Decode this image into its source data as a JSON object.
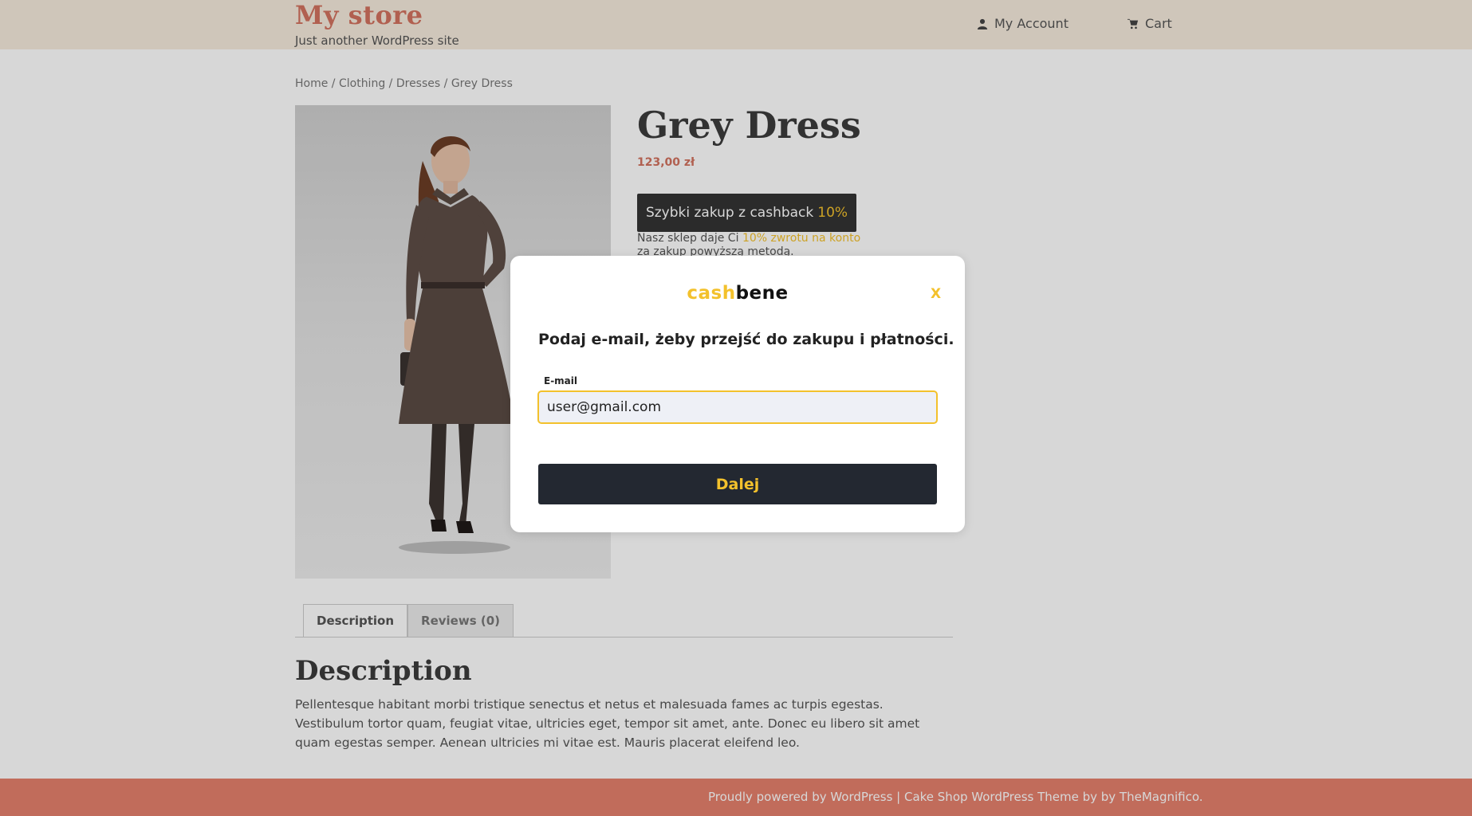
{
  "header": {
    "site_title": "My store",
    "site_description": "Just another WordPress site",
    "nav": {
      "account_label": "My Account",
      "cart_label": "Cart"
    }
  },
  "breadcrumb": {
    "items": [
      "Home",
      "Clothing",
      "Dresses",
      "Grey Dress"
    ],
    "separator": " / "
  },
  "product": {
    "title": "Grey Dress",
    "price": "123,00 zł",
    "cashback_button": {
      "label": "Szybki zakup z cashback",
      "percent": "10%"
    },
    "cashback_note": {
      "prefix": "Nasz sklep daje Ci",
      "highlight": "10% zwrotu na konto",
      "suffix": "za zakup powyższą metodą."
    }
  },
  "tabs": [
    {
      "label": "Description",
      "active": true
    },
    {
      "label": "Reviews (0)",
      "active": false
    }
  ],
  "description": {
    "title": "Description",
    "text": "Pellentesque habitant morbi tristique senectus et netus et malesuada fames ac turpis egestas. Vestibulum tortor quam, feugiat vitae, ultricies eget, tempor sit amet, ante. Donec eu libero sit amet quam egestas semper. Aenean ultricies mi vitae est. Mauris placerat eleifend leo."
  },
  "footer": {
    "text": "Proudly powered by WordPress |  Cake Shop WordPress Theme by by TheMagnifico."
  },
  "modal": {
    "logo_cash": "cash",
    "logo_bene": "bene",
    "close_label": "X",
    "heading": "Podaj e-mail, żeby przejść do zakupu i płatności.",
    "email_label": "E-mail",
    "email_value": "user@gmail.com",
    "submit_label": "Dalej"
  },
  "colors": {
    "accent": "#f3c12c",
    "brand": "#d2725f",
    "footer_bg": "#e5806d",
    "header_bg": "#f6ebdd",
    "button_dark": "#232831"
  },
  "icons": {
    "account": "user-icon",
    "cart": "cart-icon"
  }
}
